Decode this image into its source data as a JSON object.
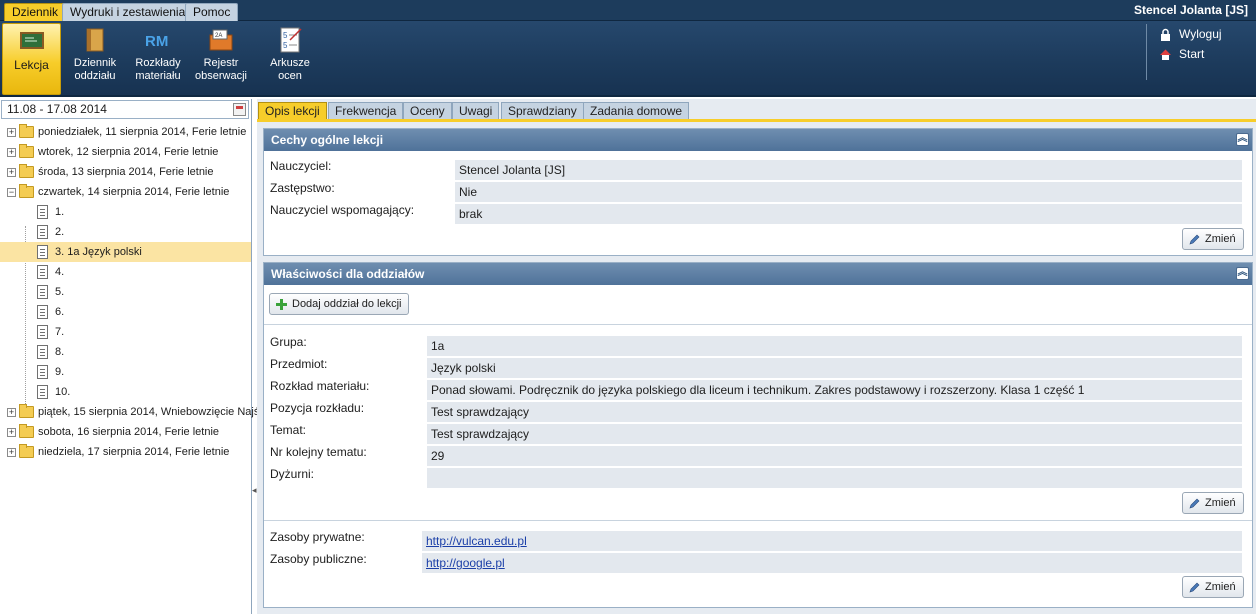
{
  "top_tabs": [
    {
      "label": "Dziennik",
      "active": true
    },
    {
      "label": "Wydruki i zestawienia",
      "active": false
    },
    {
      "label": "Pomoc",
      "active": false
    }
  ],
  "user": {
    "name": "Stencel Jolanta [JS]"
  },
  "toolbar": {
    "items": [
      {
        "label": "Lekcja",
        "icon": "chalkboard-icon",
        "active": true
      },
      {
        "label": "Dziennik oddziału",
        "icon": "journal-book-icon",
        "active": false
      },
      {
        "label": "Rozkłady materiału",
        "icon": "rm-icon",
        "active": false
      },
      {
        "label": "Rejestr obserwacji",
        "icon": "observation-folder-icon",
        "active": false
      },
      {
        "label": "Arkusze ocen",
        "icon": "grade-sheet-icon",
        "active": false
      }
    ],
    "right_links": [
      {
        "label": "Wyloguj",
        "icon": "lock-icon"
      },
      {
        "label": "Start",
        "icon": "home-icon"
      }
    ]
  },
  "left": {
    "date_range": "11.08 - 17.08 2014",
    "tree": [
      {
        "label": "poniedziałek, 11 sierpnia 2014, Ferie letnie",
        "type": "day",
        "expanded": false
      },
      {
        "label": "wtorek, 12 sierpnia 2014, Ferie letnie",
        "type": "day",
        "expanded": false
      },
      {
        "label": "środa, 13 sierpnia 2014, Ferie letnie",
        "type": "day",
        "expanded": false
      },
      {
        "label": "czwartek, 14 sierpnia 2014, Ferie letnie",
        "type": "day",
        "expanded": true
      },
      {
        "label": "1.",
        "type": "lesson"
      },
      {
        "label": "2.",
        "type": "lesson"
      },
      {
        "label": "3. 1a Język polski",
        "type": "lesson",
        "selected": true
      },
      {
        "label": "4.",
        "type": "lesson"
      },
      {
        "label": "5.",
        "type": "lesson"
      },
      {
        "label": "6.",
        "type": "lesson"
      },
      {
        "label": "7.",
        "type": "lesson"
      },
      {
        "label": "8.",
        "type": "lesson"
      },
      {
        "label": "9.",
        "type": "lesson"
      },
      {
        "label": "10.",
        "type": "lesson"
      },
      {
        "label": "piątek, 15 sierpnia 2014, Wniebowzięcie Najś",
        "type": "day",
        "expanded": false
      },
      {
        "label": "sobota, 16 sierpnia 2014, Ferie letnie",
        "type": "day",
        "expanded": false
      },
      {
        "label": "niedziela, 17 sierpnia 2014, Ferie letnie",
        "type": "day",
        "expanded": false
      }
    ]
  },
  "content": {
    "tabs": [
      {
        "label": "Opis lekcji",
        "active": true
      },
      {
        "label": "Frekwencja",
        "active": false
      },
      {
        "label": "Oceny",
        "active": false
      },
      {
        "label": "Uwagi",
        "active": false
      },
      {
        "label": "Sprawdziany",
        "active": false
      },
      {
        "label": "Zadania domowe",
        "active": false
      }
    ],
    "general": {
      "title": "Cechy ogólne lekcji",
      "fields": [
        {
          "label": "Nauczyciel:",
          "value": "Stencel Jolanta [JS]"
        },
        {
          "label": "Zastępstwo:",
          "value": "Nie"
        },
        {
          "label": "Nauczyciel wspomagający:",
          "value": "brak"
        }
      ],
      "change_label": "Zmień"
    },
    "classes": {
      "title": "Właściwości dla oddziałów",
      "add_label": "Dodaj oddział do lekcji",
      "fields": [
        {
          "label": "Grupa:",
          "value": "1a"
        },
        {
          "label": "Przedmiot:",
          "value": "Język polski"
        },
        {
          "label": "Rozkład materiału:",
          "value": "Ponad słowami. Podręcznik do języka polskiego dla liceum i technikum. Zakres podstawowy i rozszerzony. Klasa 1 część 1"
        },
        {
          "label": "Pozycja rozkładu:",
          "value": "Test sprawdzający"
        },
        {
          "label": "Temat:",
          "value": "Test sprawdzający"
        },
        {
          "label": "Nr kolejny tematu:",
          "value": "29"
        },
        {
          "label": "Dyżurni:",
          "value": ""
        }
      ],
      "change_label": "Zmień",
      "resources": [
        {
          "label": "Zasoby prywatne:",
          "value": "http://vulcan.edu.pl"
        },
        {
          "label": "Zasoby publiczne:",
          "value": "http://google.pl"
        }
      ],
      "change_label_2": "Zmień"
    }
  }
}
